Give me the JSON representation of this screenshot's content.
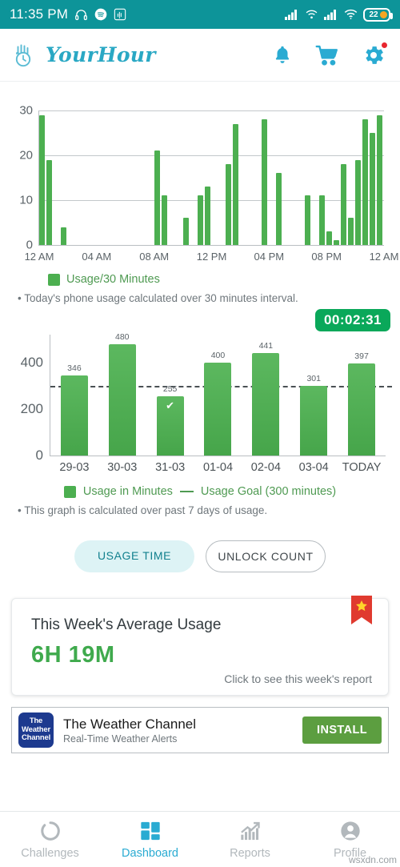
{
  "status_bar": {
    "time": "11:35 PM",
    "left_icons": [
      "headphones-icon",
      "spotify-icon",
      "app-badge-icon"
    ],
    "right_icons": [
      "signal-icon",
      "wifi-calling-icon",
      "signal-icon",
      "wifi-icon"
    ],
    "battery_level": "22",
    "background_color": "#0d9499"
  },
  "app_bar": {
    "logo_icon": "yourhour-hand-clock-icon",
    "title": "YourHour",
    "title_color": "#2aa8c4",
    "actions": [
      {
        "name": "notifications-bell",
        "icon": "bell-icon",
        "badge": false
      },
      {
        "name": "shop-cart",
        "icon": "cart-icon",
        "badge": false
      },
      {
        "name": "settings",
        "icon": "gear-icon",
        "badge": true
      }
    ]
  },
  "session_timer": {
    "value": "00:02:31",
    "color": "#0aa85a"
  },
  "chart_data": [
    {
      "type": "bar",
      "id": "today-usage-30min",
      "title": "",
      "xlabel": "",
      "ylabel": "",
      "ylim": [
        0,
        30
      ],
      "yticks": [
        0,
        10,
        20,
        30
      ],
      "grid": true,
      "legend": [
        {
          "label": "Usage/30 Minutes",
          "color": "#4caf50",
          "marker": "square"
        }
      ],
      "note": "• Today's phone usage calculated over 30 minutes interval.",
      "xticks": [
        "12 AM",
        "04 AM",
        "08 AM",
        "12 PM",
        "04 PM",
        "08 PM",
        "12 AM"
      ],
      "xtick_hours": [
        0,
        4,
        8,
        12,
        16,
        20,
        24
      ],
      "x": [
        0.0,
        0.5,
        1.5,
        8.0,
        8.5,
        10.0,
        11.0,
        11.5,
        13.0,
        13.5,
        15.5,
        16.5,
        18.5,
        19.5,
        20.0,
        20.5,
        21.0,
        21.5,
        22.0,
        22.5,
        23.0,
        23.5
      ],
      "values": [
        29,
        19,
        4,
        21,
        11,
        6,
        11,
        13,
        18,
        27,
        28,
        16,
        11,
        11,
        3,
        1,
        18,
        6,
        19,
        28,
        25,
        29
      ],
      "bar_color": "#4caf50"
    },
    {
      "type": "bar",
      "id": "past-7-days-usage",
      "title": "",
      "xlabel": "",
      "ylabel": "",
      "ylim": [
        0,
        520
      ],
      "yticks": [
        0,
        200,
        400
      ],
      "grid": false,
      "categories": [
        "29-03",
        "30-03",
        "31-03",
        "01-04",
        "02-04",
        "03-04",
        "TODAY"
      ],
      "values": [
        346,
        480,
        255,
        400,
        441,
        301,
        397
      ],
      "value_labels": [
        "346",
        "480",
        "255",
        "400",
        "441",
        "301",
        "397"
      ],
      "goal_line": 300,
      "goal_line_style": "dashed",
      "goal_met_marker": {
        "index": 2,
        "glyph": "✔"
      },
      "legend": [
        {
          "label": "Usage in Minutes",
          "color": "#4caf50",
          "marker": "square"
        },
        {
          "label": "Usage Goal (300 minutes)",
          "color": "#4f9a52",
          "marker": "line"
        }
      ],
      "note": "• This graph is calculated over past 7 days of usage.",
      "bar_color": "#4caf50"
    }
  ],
  "toggles": [
    {
      "label": "USAGE TIME",
      "active": true
    },
    {
      "label": "UNLOCK COUNT",
      "active": false
    }
  ],
  "average_card": {
    "title": "This Week's Average Usage",
    "value": "6H 19M",
    "value_color": "#3faa4d",
    "link": "Click to see this week's report",
    "ribbon_icon": "star-ribbon-icon"
  },
  "ad": {
    "logo_line1": "The",
    "logo_line2": "Weather",
    "logo_line3": "Channel",
    "title": "The Weather Channel",
    "subtitle": "Real-Time Weather Alerts",
    "cta": "INSTALL"
  },
  "bottom_nav": {
    "items": [
      {
        "label": "Challenges",
        "icon": "ring-progress-icon",
        "active": false
      },
      {
        "label": "Dashboard",
        "icon": "grid-dashboard-icon",
        "active": true
      },
      {
        "label": "Reports",
        "icon": "bar-chart-arrow-icon",
        "active": false
      },
      {
        "label": "Profile",
        "icon": "person-circle-icon",
        "active": false
      }
    ],
    "active_color": "#2aabd2",
    "inactive_color": "#b2b8bc"
  },
  "watermark": "wsxdn.com"
}
